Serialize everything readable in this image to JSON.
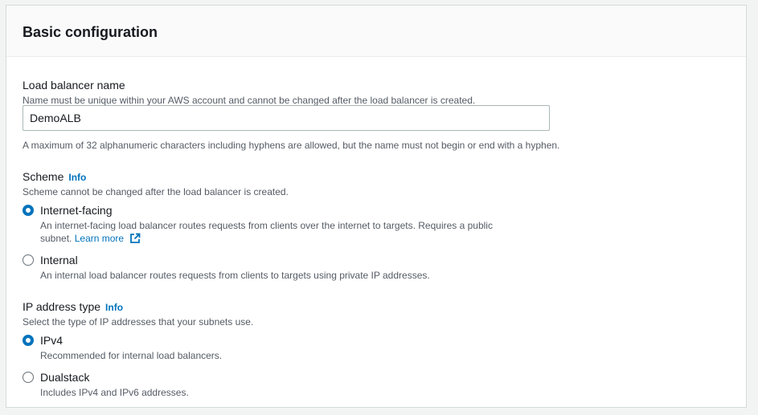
{
  "panel": {
    "title": "Basic configuration"
  },
  "name_field": {
    "label": "Load balancer name",
    "description": "Name must be unique within your AWS account and cannot be changed after the load balancer is created.",
    "value": "DemoALB",
    "constraint": "A maximum of 32 alphanumeric characters including hyphens are allowed, but the name must not begin or end with a hyphen."
  },
  "scheme": {
    "label": "Scheme",
    "info": "Info",
    "description": "Scheme cannot be changed after the load balancer is created.",
    "options": [
      {
        "label": "Internet-facing",
        "selected": true,
        "desc_line1": "An internet-facing load balancer routes requests from clients over the internet to targets. Requires a public",
        "desc_line2": "subnet.",
        "link": "Learn more",
        "link_icon": "external-link-icon"
      },
      {
        "label": "Internal",
        "selected": false,
        "desc_line1": "An internal load balancer routes requests from clients to targets using private IP addresses."
      }
    ]
  },
  "ip_type": {
    "label": "IP address type",
    "info": "Info",
    "description": "Select the type of IP addresses that your subnets use.",
    "options": [
      {
        "label": "IPv4",
        "selected": true,
        "desc": "Recommended for internal load balancers."
      },
      {
        "label": "Dualstack",
        "selected": false,
        "desc": "Includes IPv4 and IPv6 addresses."
      }
    ]
  },
  "colors": {
    "link": "#0073bb",
    "selected_radio": "#0073bb",
    "text": "#16191f",
    "muted": "#545b64"
  }
}
